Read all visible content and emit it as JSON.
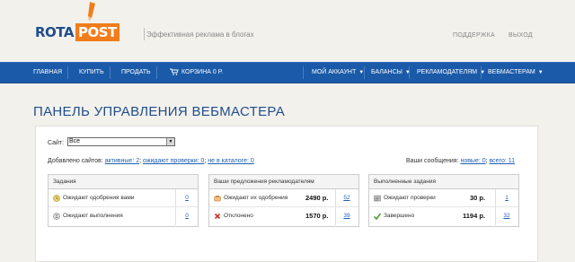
{
  "header": {
    "logo_part1": "ROTA",
    "logo_part2": "POST",
    "tagline": "Эффективная реклама в блогах",
    "support_link": "ПОДДЕРЖКА",
    "logout_link": "ВЫХОД"
  },
  "nav": {
    "items": [
      {
        "label": "ГЛАВНАЯ"
      },
      {
        "label": "КУПИТЬ"
      },
      {
        "label": "ПРОДАТЬ"
      },
      {
        "label": "КОРЗИНА 0 Р."
      },
      {
        "label": "МОЙ АККАУНТ"
      },
      {
        "label": "БАЛАНСЫ"
      },
      {
        "label": "РЕКЛАМОДАТЕЛЯМ"
      },
      {
        "label": "ВЕБМАСТЕРАМ"
      }
    ]
  },
  "page_title": "ПАНЕЛЬ УПРАВЛЕНИЯ ВЕБМАСТЕРА",
  "site_filter": {
    "label": "Сайт:",
    "selected": "Все"
  },
  "added_sites": {
    "prefix": "Добавлено сайтов:",
    "active_label": "активные: 2",
    "pending_label": "ожидают проверки: 0",
    "not_in_catalog_label": "не в каталоге: 0",
    "sep1": ";",
    "sep2": ";"
  },
  "messages": {
    "prefix": "Ваши сообщения:",
    "new_label": "новые: 0",
    "sep": ";",
    "total_label": "всего: 11"
  },
  "tasks": {
    "title": "Задания",
    "rows": [
      {
        "label": "Ожидают одобрения вами",
        "count": "0",
        "icon": "clock-icon"
      },
      {
        "label": "Ожидают выполнения",
        "count": "0",
        "icon": "hourglass-icon"
      }
    ]
  },
  "offers": {
    "title": "Ваши предложения рекламодателям",
    "rows": [
      {
        "label": "Ожидают их одобрения",
        "amount": "2490 р.",
        "count": "52",
        "icon": "scales-icon"
      },
      {
        "label": "Отклонено",
        "amount": "1570 р.",
        "count": "39",
        "icon": "cross-icon"
      }
    ]
  },
  "completed": {
    "title": "Выполненные задания",
    "rows": [
      {
        "label": "Ожидают проверки",
        "amount": "30 р.",
        "count": "1",
        "icon": "document-icon"
      },
      {
        "label": "Завершено",
        "amount": "1194 р.",
        "count": "32",
        "icon": "checkmark-icon"
      }
    ]
  },
  "colors": {
    "brand_blue": "#1f4e8c",
    "brand_orange": "#f07d1a",
    "nav_blue": "#1a5aa8",
    "link_blue": "#1f5fb0"
  }
}
